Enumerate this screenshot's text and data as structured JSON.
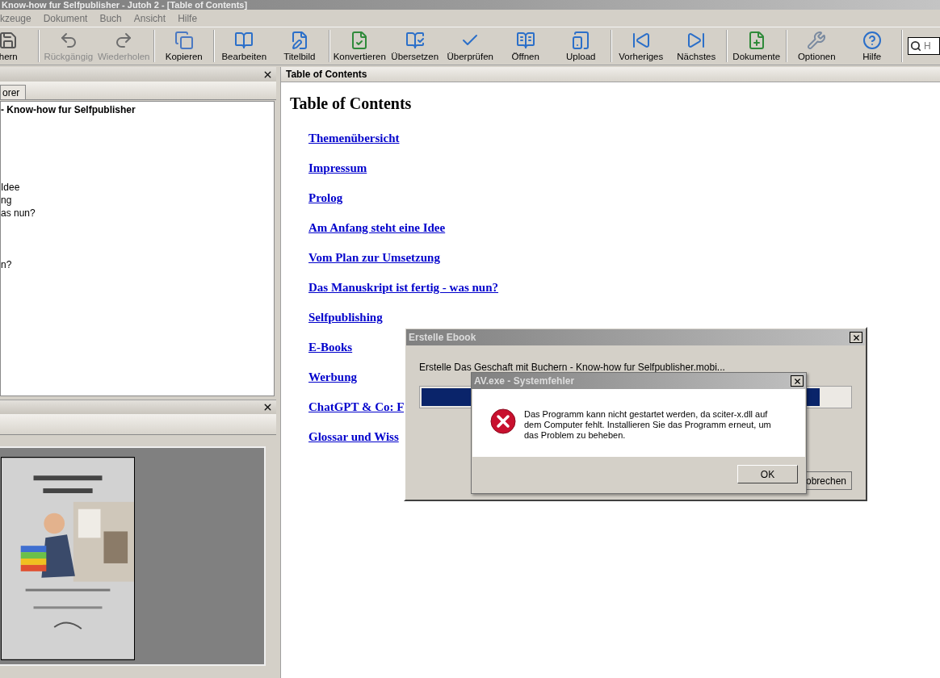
{
  "window": {
    "title": "Know-how fur Selfpublisher - Jutoh 2 - [Table of Contents]"
  },
  "menu": [
    "kzeuge",
    "Dokument",
    "Buch",
    "Ansicht",
    "Hilfe"
  ],
  "toolbar": [
    {
      "items": [
        {
          "label": "hern",
          "disabled": false
        }
      ]
    },
    {
      "items": [
        {
          "label": "Rückgängig",
          "disabled": true
        },
        {
          "label": "Wiederholen",
          "disabled": true
        }
      ]
    },
    {
      "items": [
        {
          "label": "Kopieren",
          "disabled": false
        }
      ]
    },
    {
      "items": [
        {
          "label": "Bearbeiten",
          "disabled": false
        },
        {
          "label": "Titelbild",
          "disabled": false
        }
      ]
    },
    {
      "items": [
        {
          "label": "Konvertieren",
          "disabled": false
        },
        {
          "label": "Übersetzen",
          "disabled": false
        },
        {
          "label": "Überprüfen",
          "disabled": false
        },
        {
          "label": "Öffnen",
          "disabled": false
        },
        {
          "label": "Upload",
          "disabled": false
        }
      ]
    },
    {
      "items": [
        {
          "label": "Vorheriges",
          "disabled": false
        },
        {
          "label": "Nächstes",
          "disabled": false
        }
      ]
    },
    {
      "items": [
        {
          "label": "Dokumente",
          "disabled": false
        }
      ]
    },
    {
      "items": [
        {
          "label": "Optionen",
          "disabled": false
        },
        {
          "label": "Hilfe",
          "disabled": false
        }
      ]
    }
  ],
  "search": {
    "placeholder": "H"
  },
  "explorer": {
    "tabs": [
      {
        "label": "orer",
        "selected": true
      }
    ],
    "tree": [
      {
        "text": "- Know-how fur Selfpublisher",
        "bold": true
      },
      {
        "text": "Idee",
        "bold": false
      },
      {
        "text": "ng",
        "bold": false
      },
      {
        "text": "as nun?",
        "bold": false
      },
      {
        "text": "n?",
        "bold": false
      }
    ]
  },
  "document": {
    "tab_title": "Table of Contents",
    "heading": "Table of Contents",
    "links": [
      "Themenübersicht",
      "Impressum",
      "Prolog",
      "Am Anfang steht eine Idee",
      "Vom Plan zur Umsetzung",
      "Das Manuskript ist fertig - was nun?",
      "Selfpublishing",
      "E-Books",
      "Werbung",
      "ChatGPT & Co: F",
      "Glossar und Wiss"
    ]
  },
  "progress_dialog": {
    "title": "Erstelle Ebook",
    "message": "Erstelle Das Geschaft mit Buchern - Know-how fur Selfpublisher.mobi...",
    "level": 0.93,
    "button": "obrechen"
  },
  "error_dialog": {
    "title": "AV.exe - Systemfehler",
    "message": "Das Programm kann nicht gestartet werden, da sciter-x.dll auf dem Computer fehlt. Installieren Sie das Programm erneut, um das Problem zu beheben.",
    "button": "OK"
  }
}
